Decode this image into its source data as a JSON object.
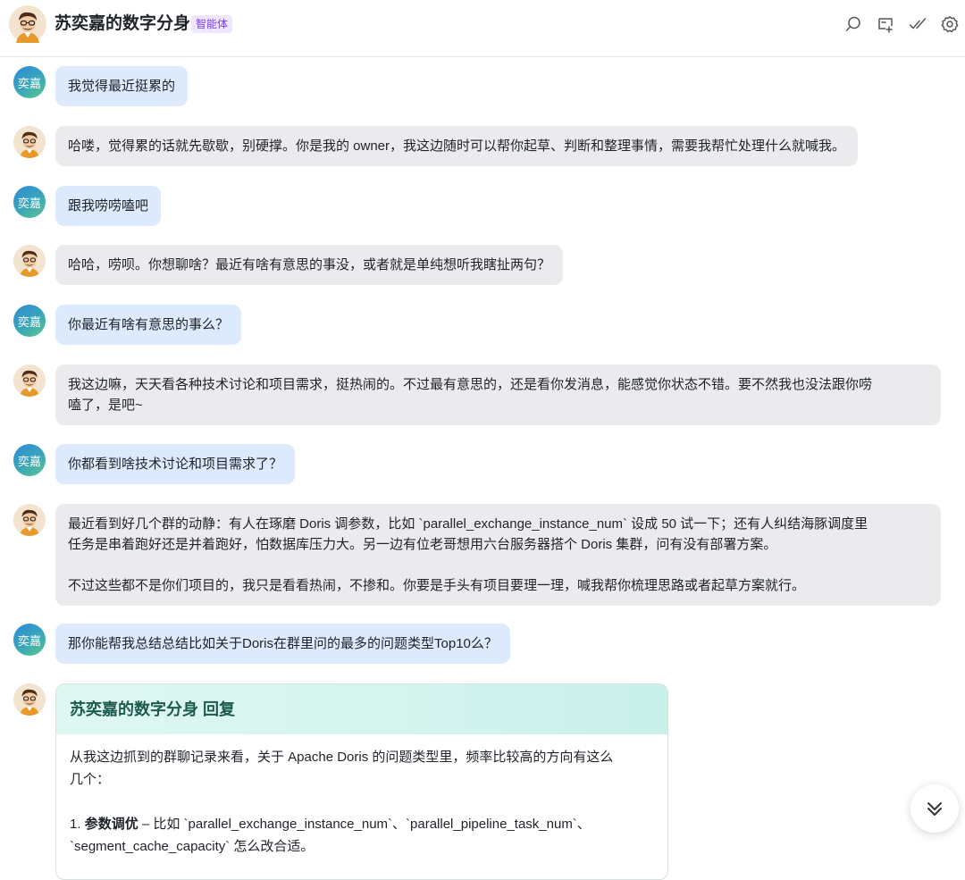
{
  "header": {
    "title": "苏奕嘉的数字分身",
    "tag": "智能体",
    "icons": [
      "search-icon",
      "new-chat-icon",
      "check-icon",
      "settings-icon"
    ]
  },
  "user_avatar_text": "奕嘉",
  "messages": [
    {
      "role": "user",
      "text": "我觉得最近挺累的"
    },
    {
      "role": "bot",
      "text": "哈喽，觉得累的话就先歇歇，别硬撑。你是我的 owner，我这边随时可以帮你起草、判断和整理事情，需要我帮忙处理什么就喊我。"
    },
    {
      "role": "user",
      "text": "跟我唠唠嗑吧"
    },
    {
      "role": "bot",
      "text": "哈哈，唠呗。你想聊啥？最近有啥有意思的事没，或者就是单纯想听我瞎扯两句？"
    },
    {
      "role": "user",
      "text": "你最近有啥有意思的事么？"
    },
    {
      "role": "bot",
      "lines": [
        "我这边嘛，天天看各种技术讨论和项目需求，挺热闹的。不过最有意思的，还是看你发消息，能感觉你状态不错。要不然我也没法跟你唠",
        "嗑了，是吧~"
      ]
    },
    {
      "role": "user",
      "text": "你都看到啥技术讨论和项目需求了？"
    },
    {
      "role": "bot",
      "lines": [
        "最近看到好几个群的动静：有人在琢磨 Doris 调参数，比如 `parallel_exchange_instance_num` 设成 50 试一下；还有人纠结海豚调度里",
        "任务是串着跑好还是并着跑好，怕数据库压力大。另一边有位老哥想用六台服务器搭个 Doris 集群，问有没有部署方案。",
        "",
        "不过这些都不是你们项目的，我只是看看热闹，不掺和。你要是手头有项目要理一理，喊我帮你梳理思路或者起草方案就行。"
      ]
    },
    {
      "role": "user",
      "text": "那你能帮我总结总结比如关于Doris在群里问的最多的问题类型Top10么？"
    }
  ],
  "reply_card": {
    "title": "苏奕嘉的数字分身 回复",
    "intro_line1": "从我这边抓到的群聊记录来看，关于 Apache Doris 的问题类型里，频率比较高的方向有这么",
    "intro_line2": "几个：",
    "item1_prefix": "1. ",
    "item1_bold": "参数调优",
    "item1_text": " – 比如 `parallel_exchange_instance_num`、`parallel_pipeline_task_num`、",
    "item1_text2": "`segment_cache_capacity` 怎么改合适。"
  },
  "scroll_button": "scroll-to-bottom"
}
